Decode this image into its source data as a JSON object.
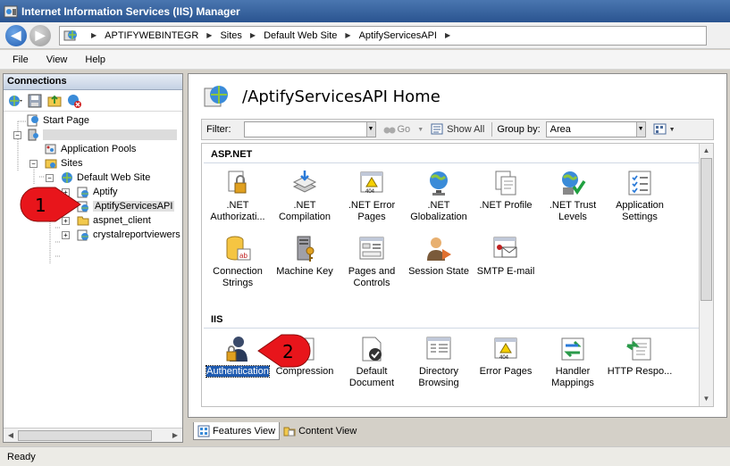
{
  "window": {
    "title": "Internet Information Services (IIS) Manager"
  },
  "address": {
    "breadcrumbs": [
      "APTIFYWEBINTEGR",
      "Sites",
      "Default Web Site",
      "AptifyServicesAPI"
    ]
  },
  "menu": {
    "items": [
      "File",
      "View",
      "Help"
    ]
  },
  "connections": {
    "title": "Connections",
    "tree": [
      {
        "label": "Start Page",
        "icon": "start-page-icon"
      },
      {
        "label": "",
        "icon": "server-icon"
      },
      {
        "label": "Application Pools",
        "icon": "app-pools-icon"
      },
      {
        "label": "Sites",
        "icon": "sites-folder-icon"
      },
      {
        "label": "Default Web Site",
        "icon": "globe-icon"
      },
      {
        "label": "Aptify",
        "icon": "application-icon"
      },
      {
        "label": "AptifyServicesAPI",
        "icon": "application-icon"
      },
      {
        "label": "aspnet_client",
        "icon": "folder-icon"
      },
      {
        "label": "crystalreportviewers",
        "icon": "application-icon"
      }
    ]
  },
  "content": {
    "title": "/AptifyServicesAPI Home",
    "filter_label": "Filter:",
    "go_label": "Go",
    "show_all_label": "Show All",
    "group_by_label": "Group by:",
    "group_by_value": "Area",
    "sections": [
      {
        "name": "ASP.NET",
        "features": [
          {
            "label": ".NET Authorizati...",
            "icon": "lock-doc-icon"
          },
          {
            "label": ".NET Compilation",
            "icon": "compilation-icon"
          },
          {
            "label": ".NET Error Pages",
            "icon": "error-page-icon"
          },
          {
            "label": ".NET Globalization",
            "icon": "globe-icon"
          },
          {
            "label": ".NET Profile",
            "icon": "profile-icon"
          },
          {
            "label": ".NET Trust Levels",
            "icon": "trust-icon"
          },
          {
            "label": "Application Settings",
            "icon": "settings-list-icon"
          },
          {
            "label": "Connection Strings",
            "icon": "db-icon"
          },
          {
            "label": "Machine Key",
            "icon": "machine-key-icon"
          },
          {
            "label": "Pages and Controls",
            "icon": "pages-icon"
          },
          {
            "label": "Session State",
            "icon": "session-icon"
          },
          {
            "label": "SMTP E-mail",
            "icon": "smtp-icon"
          }
        ]
      },
      {
        "name": "IIS",
        "features": [
          {
            "label": "Authentication",
            "icon": "authentication-icon"
          },
          {
            "label": "Compression",
            "icon": "compression-icon"
          },
          {
            "label": "Default Document",
            "icon": "default-doc-icon"
          },
          {
            "label": "Directory Browsing",
            "icon": "dir-browse-icon"
          },
          {
            "label": "Error Pages",
            "icon": "error-page-icon"
          },
          {
            "label": "Handler Mappings",
            "icon": "handler-icon"
          },
          {
            "label": "HTTP Respo...",
            "icon": "http-response-icon"
          }
        ]
      }
    ]
  },
  "view_tabs": {
    "features_view": "Features View",
    "content_view": "Content View"
  },
  "status": {
    "text": "Ready"
  },
  "callouts": {
    "one": "1",
    "two": "2"
  },
  "colors": {
    "callout_red": "#e8151b",
    "selection_blue": "#1f5bb0"
  }
}
